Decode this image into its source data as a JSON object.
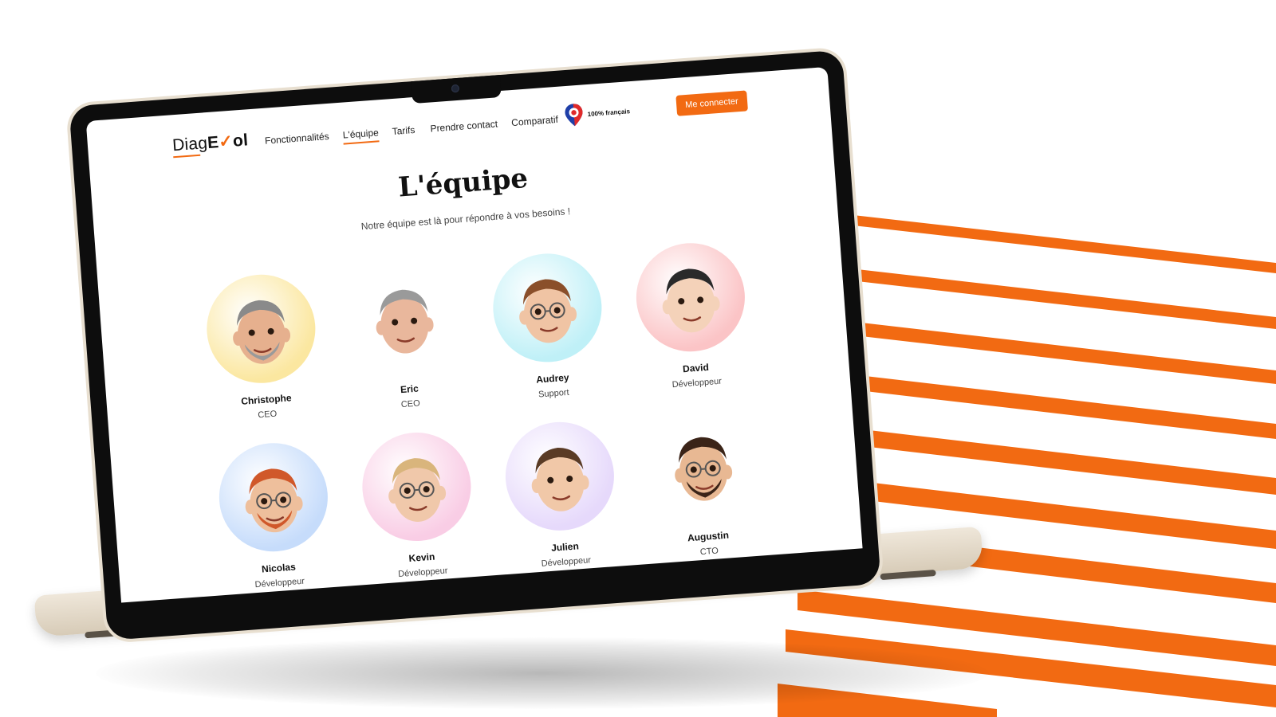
{
  "brand": {
    "name_prefix": "Diag",
    "name_e": "E",
    "name_check": "✓",
    "name_suffix": "ol"
  },
  "nav": {
    "links": [
      "Fonctionnalités",
      "L'équipe",
      "Tarifs",
      "Prendre contact",
      "Comparatif"
    ],
    "active": "L'équipe",
    "badge": "100% français",
    "login_label": "Me connecter"
  },
  "page": {
    "title": "L'équipe",
    "subtitle": "Notre équipe est là pour répondre à vos besoins !"
  },
  "team": [
    {
      "name": "Christophe",
      "role": "CEO",
      "bg": "#fbe7a0",
      "skin": "#e6b08e",
      "hair": "#8a8a8a"
    },
    {
      "name": "Eric",
      "role": "CEO",
      "bg": "#ffffff",
      "skin": "#e9b79c",
      "hair": "#9a9a9a"
    },
    {
      "name": "Audrey",
      "role": "Support",
      "bg": "#bff0f7",
      "skin": "#f0c4a4",
      "hair": "#8a4f2a"
    },
    {
      "name": "David",
      "role": "Développeur",
      "bg": "#fbc4c6",
      "skin": "#f4d2b9",
      "hair": "#2a2a2a"
    },
    {
      "name": "Nicolas",
      "role": "Développeur",
      "bg": "#c6dcfb",
      "skin": "#eebf9c",
      "hair": "#d0582a"
    },
    {
      "name": "Kevin",
      "role": "Développeur",
      "bg": "#f9cde5",
      "skin": "#f0c8aa",
      "hair": "#d9b57c"
    },
    {
      "name": "Julien",
      "role": "Développeur",
      "bg": "#e6d9fb",
      "skin": "#f1c8a8",
      "hair": "#5a3b25"
    },
    {
      "name": "Augustin",
      "role": "CTO",
      "bg": "#ffffff",
      "skin": "#e8b893",
      "hair": "#3b2418"
    }
  ],
  "colors": {
    "accent": "#f26a12"
  }
}
